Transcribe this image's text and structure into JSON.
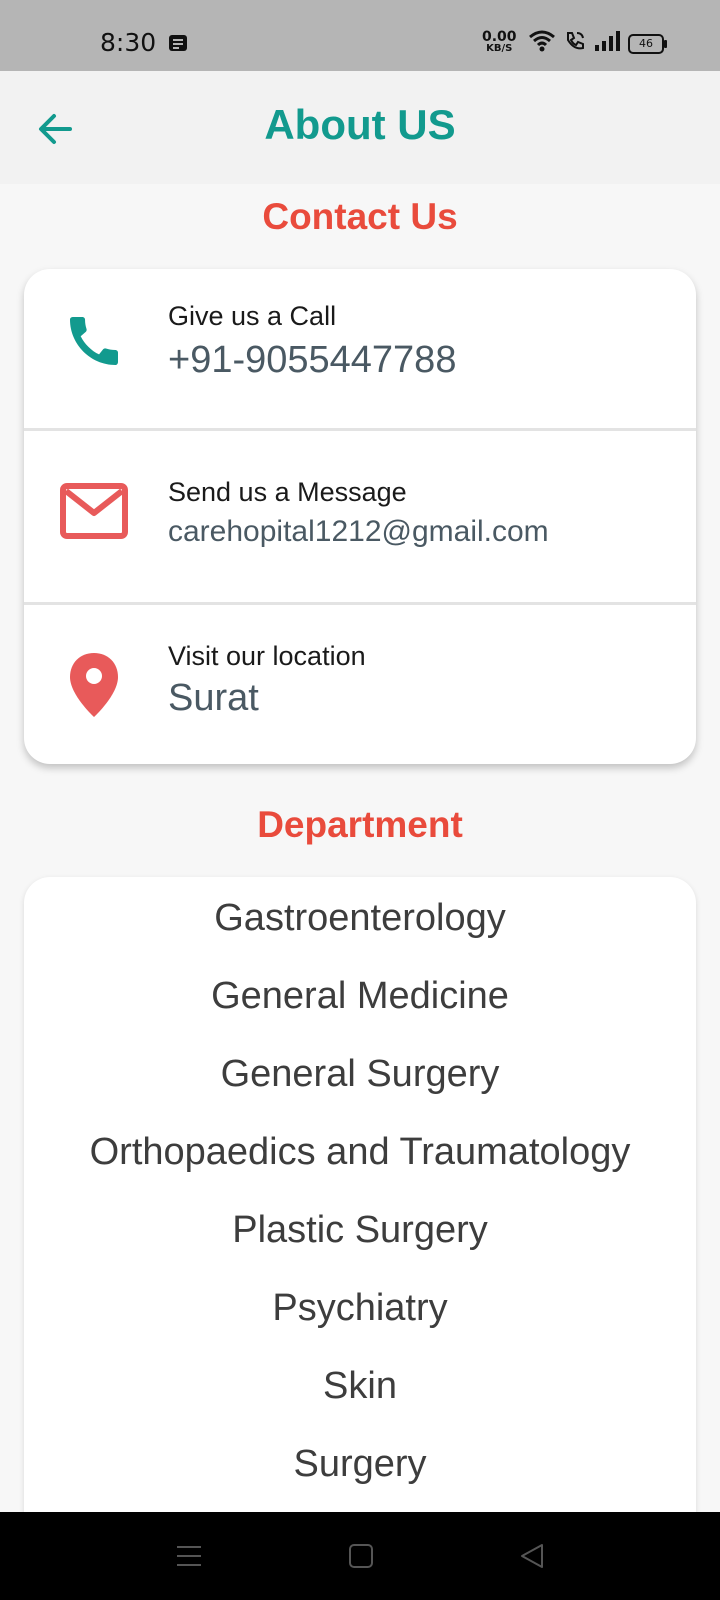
{
  "status_bar": {
    "time": "8:30",
    "net_speed_value": "0.00",
    "net_speed_unit": "KB/S",
    "battery": "46"
  },
  "app_bar": {
    "title": "About US",
    "back_icon": "arrow-left-icon"
  },
  "contact": {
    "title": "Contact Us",
    "call": {
      "label": "Give us a Call",
      "value": "+91-9055447788",
      "icon": "phone-icon",
      "color": "#129a8e"
    },
    "message": {
      "label": "Send us a Message",
      "value": "carehopital1212@gmail.com",
      "icon": "mail-icon",
      "color": "#e85a5a"
    },
    "location": {
      "label": "Visit our location",
      "value": "Surat",
      "icon": "location-pin-icon",
      "color": "#e85a5a"
    }
  },
  "department": {
    "title": "Department",
    "items": [
      "Gastroenterology",
      "General Medicine",
      "General Surgery",
      "Orthopaedics and Traumatology",
      "Plastic Surgery",
      "Psychiatry",
      "Skin",
      "Surgery"
    ]
  },
  "nav_bar": {
    "icons": [
      "menu-icon",
      "home-square-icon",
      "back-triangle-icon"
    ]
  },
  "colors": {
    "accent_teal": "#129a8e",
    "accent_red": "#e94b3c",
    "background": "#f7f7f7"
  }
}
